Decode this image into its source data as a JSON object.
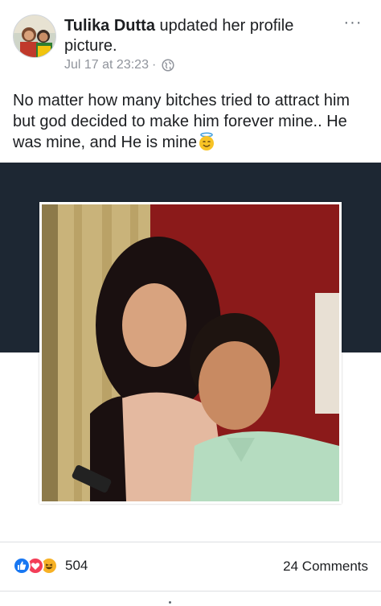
{
  "post": {
    "author": "Tulika Dutta",
    "action": "updated her profile picture.",
    "timestamp": "Jul 17 at 23:23",
    "separator": "·",
    "privacy_icon": "globe-icon",
    "more_icon": "ellipsis-icon",
    "more_label": "···",
    "text": "No matter how many bitches tried to attract him but god decided to make him forever mine.. He was mine, and  He is mine",
    "emoji_icon": "smiling-face-with-halo-icon"
  },
  "engagement": {
    "reaction_icons": [
      "like-icon",
      "love-icon",
      "haha-icon"
    ],
    "reaction_count": "504",
    "comments_label": "24 Comments"
  },
  "colors": {
    "cover": "#1d2733",
    "like": "#1877f2",
    "love": "#f33e58",
    "haha": "#f7b125",
    "meta": "#90949c"
  }
}
